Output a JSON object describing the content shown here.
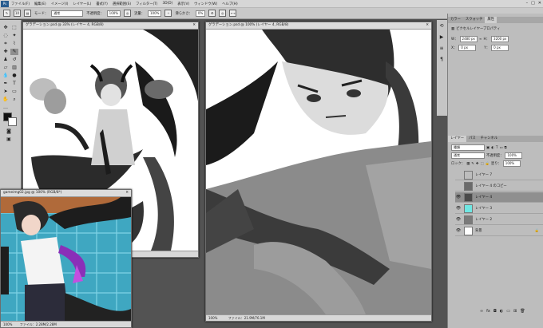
{
  "menu": [
    "ファイル(F)",
    "編集(E)",
    "イメージ(I)",
    "レイヤー(L)",
    "書式(Y)",
    "選択範囲(S)",
    "フィルター(T)",
    "3D(D)",
    "表示(V)",
    "ウィンドウ(W)",
    "ヘルプ(H)"
  ],
  "options": {
    "mode_label": "モード：",
    "mode_value": "通常",
    "opacity_label": "不透明度：",
    "opacity_value": "100%",
    "flow_label": "流量：",
    "flow_value": "100%",
    "smooth_label": "滑らかさ：",
    "smooth_value": "0%",
    "brush_size": "10"
  },
  "docs": {
    "left_title": "グラデーション.psd @ 33% (レイヤー 4, RGB/8)",
    "main_title": "グラデーション.psd @ 100% (レイヤー 4, RGB/8)",
    "small_title": "gameimg02.jpg @ 100% (RGB/8*)",
    "left_status": "",
    "main_zoom": "100%",
    "main_file": "ファイル：21.9M/76.1M",
    "small_zoom": "100%",
    "small_file": "ファイル：2.28M/2.28M"
  },
  "panels": {
    "top_tabs": [
      "カラー",
      "スウォッチ",
      "属性"
    ],
    "props_title": "ピクセルレイヤープロパティ",
    "w_label": "W：",
    "w_value": "2480 px",
    "h_label": "H：",
    "h_value": "3200 px",
    "x_label": "X：",
    "x_value": "0 px",
    "y_label": "Y：",
    "y_value": "0 px",
    "layer_tabs": [
      "レイヤー",
      "パス",
      "チャンネル"
    ],
    "kind_label": "種類",
    "blend": "通常",
    "opacity_label": "不透明度：",
    "opacity": "100%",
    "lock_label": "ロック：",
    "fill_label": "塗り：",
    "fill": "100%",
    "layers": [
      {
        "name": "レイヤー 7",
        "visible": false,
        "thumb": "#bdbdbd",
        "selected": false
      },
      {
        "name": "レイヤー 4 のコピー",
        "visible": false,
        "thumb": "#6b6b6b",
        "selected": false
      },
      {
        "name": "レイヤー 4",
        "visible": true,
        "thumb": "#4a4a4a",
        "selected": true
      },
      {
        "name": "レイヤー 3",
        "visible": true,
        "thumb": "#6fe7e3",
        "selected": false
      },
      {
        "name": "レイヤー 2",
        "visible": true,
        "thumb": "#7a7a7a",
        "selected": false
      },
      {
        "name": "背景",
        "visible": true,
        "thumb": "#ffffff",
        "selected": false
      }
    ]
  },
  "colors": {
    "fg": "#111111",
    "bg": "#ffffff",
    "accent_cyan": "#6fe7e3"
  }
}
